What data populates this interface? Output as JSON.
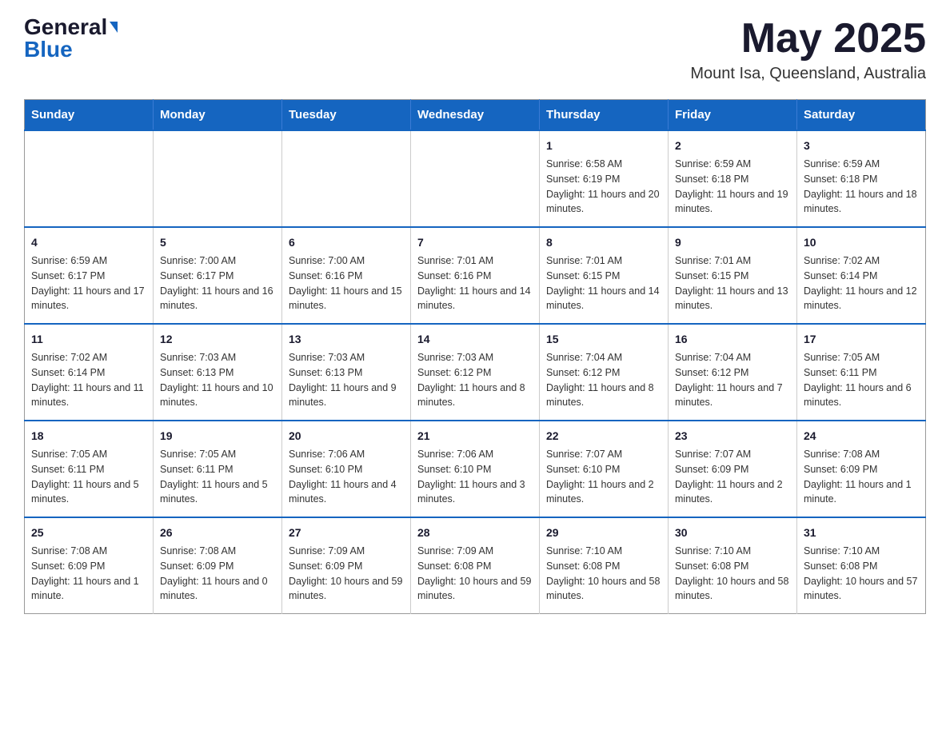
{
  "logo": {
    "general": "General",
    "blue": "Blue"
  },
  "title": "May 2025",
  "location": "Mount Isa, Queensland, Australia",
  "weekdays": [
    "Sunday",
    "Monday",
    "Tuesday",
    "Wednesday",
    "Thursday",
    "Friday",
    "Saturday"
  ],
  "weeks": [
    [
      {
        "day": "",
        "info": ""
      },
      {
        "day": "",
        "info": ""
      },
      {
        "day": "",
        "info": ""
      },
      {
        "day": "",
        "info": ""
      },
      {
        "day": "1",
        "info": "Sunrise: 6:58 AM\nSunset: 6:19 PM\nDaylight: 11 hours and 20 minutes."
      },
      {
        "day": "2",
        "info": "Sunrise: 6:59 AM\nSunset: 6:18 PM\nDaylight: 11 hours and 19 minutes."
      },
      {
        "day": "3",
        "info": "Sunrise: 6:59 AM\nSunset: 6:18 PM\nDaylight: 11 hours and 18 minutes."
      }
    ],
    [
      {
        "day": "4",
        "info": "Sunrise: 6:59 AM\nSunset: 6:17 PM\nDaylight: 11 hours and 17 minutes."
      },
      {
        "day": "5",
        "info": "Sunrise: 7:00 AM\nSunset: 6:17 PM\nDaylight: 11 hours and 16 minutes."
      },
      {
        "day": "6",
        "info": "Sunrise: 7:00 AM\nSunset: 6:16 PM\nDaylight: 11 hours and 15 minutes."
      },
      {
        "day": "7",
        "info": "Sunrise: 7:01 AM\nSunset: 6:16 PM\nDaylight: 11 hours and 14 minutes."
      },
      {
        "day": "8",
        "info": "Sunrise: 7:01 AM\nSunset: 6:15 PM\nDaylight: 11 hours and 14 minutes."
      },
      {
        "day": "9",
        "info": "Sunrise: 7:01 AM\nSunset: 6:15 PM\nDaylight: 11 hours and 13 minutes."
      },
      {
        "day": "10",
        "info": "Sunrise: 7:02 AM\nSunset: 6:14 PM\nDaylight: 11 hours and 12 minutes."
      }
    ],
    [
      {
        "day": "11",
        "info": "Sunrise: 7:02 AM\nSunset: 6:14 PM\nDaylight: 11 hours and 11 minutes."
      },
      {
        "day": "12",
        "info": "Sunrise: 7:03 AM\nSunset: 6:13 PM\nDaylight: 11 hours and 10 minutes."
      },
      {
        "day": "13",
        "info": "Sunrise: 7:03 AM\nSunset: 6:13 PM\nDaylight: 11 hours and 9 minutes."
      },
      {
        "day": "14",
        "info": "Sunrise: 7:03 AM\nSunset: 6:12 PM\nDaylight: 11 hours and 8 minutes."
      },
      {
        "day": "15",
        "info": "Sunrise: 7:04 AM\nSunset: 6:12 PM\nDaylight: 11 hours and 8 minutes."
      },
      {
        "day": "16",
        "info": "Sunrise: 7:04 AM\nSunset: 6:12 PM\nDaylight: 11 hours and 7 minutes."
      },
      {
        "day": "17",
        "info": "Sunrise: 7:05 AM\nSunset: 6:11 PM\nDaylight: 11 hours and 6 minutes."
      }
    ],
    [
      {
        "day": "18",
        "info": "Sunrise: 7:05 AM\nSunset: 6:11 PM\nDaylight: 11 hours and 5 minutes."
      },
      {
        "day": "19",
        "info": "Sunrise: 7:05 AM\nSunset: 6:11 PM\nDaylight: 11 hours and 5 minutes."
      },
      {
        "day": "20",
        "info": "Sunrise: 7:06 AM\nSunset: 6:10 PM\nDaylight: 11 hours and 4 minutes."
      },
      {
        "day": "21",
        "info": "Sunrise: 7:06 AM\nSunset: 6:10 PM\nDaylight: 11 hours and 3 minutes."
      },
      {
        "day": "22",
        "info": "Sunrise: 7:07 AM\nSunset: 6:10 PM\nDaylight: 11 hours and 2 minutes."
      },
      {
        "day": "23",
        "info": "Sunrise: 7:07 AM\nSunset: 6:09 PM\nDaylight: 11 hours and 2 minutes."
      },
      {
        "day": "24",
        "info": "Sunrise: 7:08 AM\nSunset: 6:09 PM\nDaylight: 11 hours and 1 minute."
      }
    ],
    [
      {
        "day": "25",
        "info": "Sunrise: 7:08 AM\nSunset: 6:09 PM\nDaylight: 11 hours and 1 minute."
      },
      {
        "day": "26",
        "info": "Sunrise: 7:08 AM\nSunset: 6:09 PM\nDaylight: 11 hours and 0 minutes."
      },
      {
        "day": "27",
        "info": "Sunrise: 7:09 AM\nSunset: 6:09 PM\nDaylight: 10 hours and 59 minutes."
      },
      {
        "day": "28",
        "info": "Sunrise: 7:09 AM\nSunset: 6:08 PM\nDaylight: 10 hours and 59 minutes."
      },
      {
        "day": "29",
        "info": "Sunrise: 7:10 AM\nSunset: 6:08 PM\nDaylight: 10 hours and 58 minutes."
      },
      {
        "day": "30",
        "info": "Sunrise: 7:10 AM\nSunset: 6:08 PM\nDaylight: 10 hours and 58 minutes."
      },
      {
        "day": "31",
        "info": "Sunrise: 7:10 AM\nSunset: 6:08 PM\nDaylight: 10 hours and 57 minutes."
      }
    ]
  ]
}
